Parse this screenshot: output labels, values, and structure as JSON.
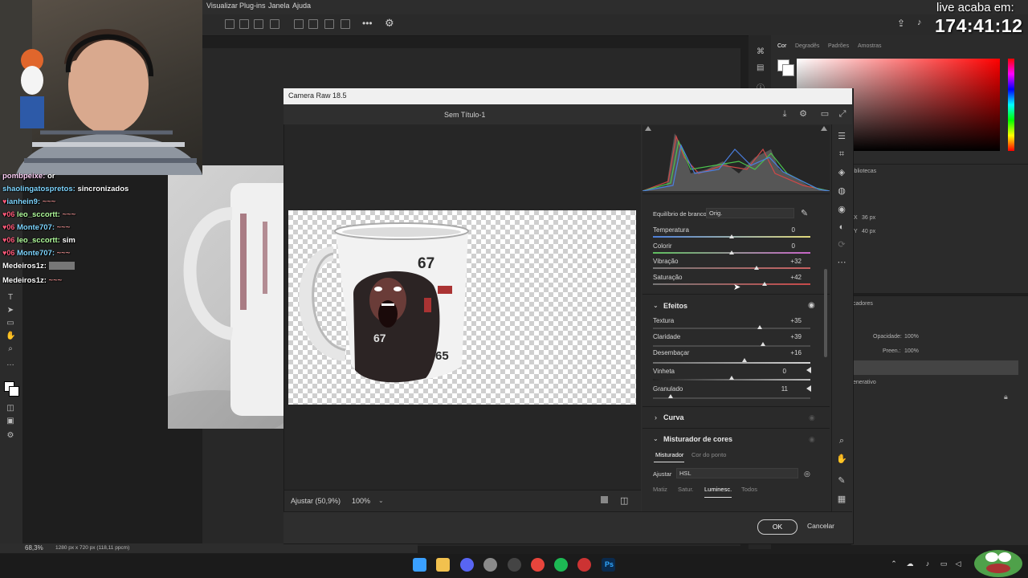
{
  "photoshop": {
    "menu": [
      "Visualizar",
      "Plug-ins",
      "Janela",
      "Ajuda"
    ],
    "color_panel_tabs": [
      "Cor",
      "Degradês",
      "Padrões",
      "Amostras"
    ],
    "props_panel_tab": "ibliotecas",
    "props": {
      "x": "36 px",
      "y": "40 px"
    },
    "layers_panel_tab": "cadores",
    "opacity_label": "Opacidade:",
    "opacity_value": "100%",
    "fill_label": "Preen.:",
    "fill_value": "100%",
    "layer_name": "enerativo",
    "status_zoom": "68,3%",
    "status_doc": "1280 px x 720 px (118,11 ppcm)"
  },
  "stream": {
    "timer_label": "live acaba em:",
    "timer_value": "174:41:12",
    "chat": [
      {
        "user": "pombpeixe:",
        "msg": "or"
      },
      {
        "user": "shaolingatospretos:",
        "msg": "sincronizados"
      },
      {
        "user": "ianhein9:",
        "msg": "~~~"
      },
      {
        "user": "leo_sccortt:",
        "msg": "~~~"
      },
      {
        "user": "Monte707:",
        "msg": "~~~"
      },
      {
        "user": "leo_sccortt:",
        "msg": "sim"
      },
      {
        "user": "Monte707:",
        "msg": "~~~"
      },
      {
        "user": "Medeiros1z:",
        "msg": ""
      },
      {
        "user": "Medeiros1z:",
        "msg": "~~~"
      }
    ]
  },
  "camera_raw": {
    "window_title": "Camera Raw 18.5",
    "doc_title": "Sem Título-1",
    "zoom_fit": "Ajustar (50,9%)",
    "zoom_value": "100%",
    "white_balance_label": "Equilíbrio de branco",
    "white_balance_value": "Orig.",
    "sliders_basic": [
      {
        "label": "Temperatura",
        "value": "0",
        "pos": 0.5,
        "gradient": "linear-gradient(to right,#4d7fd9,#e0d87a)"
      },
      {
        "label": "Colorir",
        "value": "0",
        "pos": 0.5,
        "gradient": "linear-gradient(to right,#5fbf5f,#c865c8)"
      },
      {
        "label": "Vibração",
        "value": "+32",
        "pos": 0.66,
        "gradient": "linear-gradient(to right,#777,#c86060)"
      },
      {
        "label": "Saturação",
        "value": "+42",
        "pos": 0.71,
        "gradient": "linear-gradient(to right,#777,#c84a4a)"
      }
    ],
    "effects_title": "Efeitos",
    "sliders_effects": [
      {
        "label": "Textura",
        "value": "+35",
        "pos": 0.68
      },
      {
        "label": "Claridade",
        "value": "+39",
        "pos": 0.7
      },
      {
        "label": "Desembaçar",
        "value": "+16",
        "pos": 0.58
      },
      {
        "label": "Vinheta",
        "value": "0",
        "pos": 0.5
      },
      {
        "label": "Granulado",
        "value": "11",
        "pos": 0.11
      }
    ],
    "curve_title": "Curva",
    "mixer_title": "Misturador de cores",
    "mixer_tabs": [
      "Misturador",
      "Cor do ponto"
    ],
    "adjust_label": "Ajustar",
    "adjust_value": "HSL",
    "mixer_subtabs": [
      "Matiz",
      "Satur.",
      "Luminesc.",
      "Todos"
    ],
    "ok_label": "OK",
    "cancel_label": "Cancelar",
    "mug_text": [
      "67",
      "67",
      "65"
    ]
  },
  "taskbar": {
    "apps": [
      {
        "name": "windows-start",
        "color": "#3aa0ff"
      },
      {
        "name": "file-explorer",
        "color": "#f2c14e"
      },
      {
        "name": "discord",
        "color": "#5865f2"
      },
      {
        "name": "settings",
        "color": "#8a8a8a"
      },
      {
        "name": "obs",
        "color": "#444"
      },
      {
        "name": "chrome",
        "color": "#e8453c"
      },
      {
        "name": "spotify",
        "color": "#1db954"
      },
      {
        "name": "media-player",
        "color": "#c33"
      },
      {
        "name": "photoshop",
        "color": "#0a2a4d"
      }
    ]
  }
}
